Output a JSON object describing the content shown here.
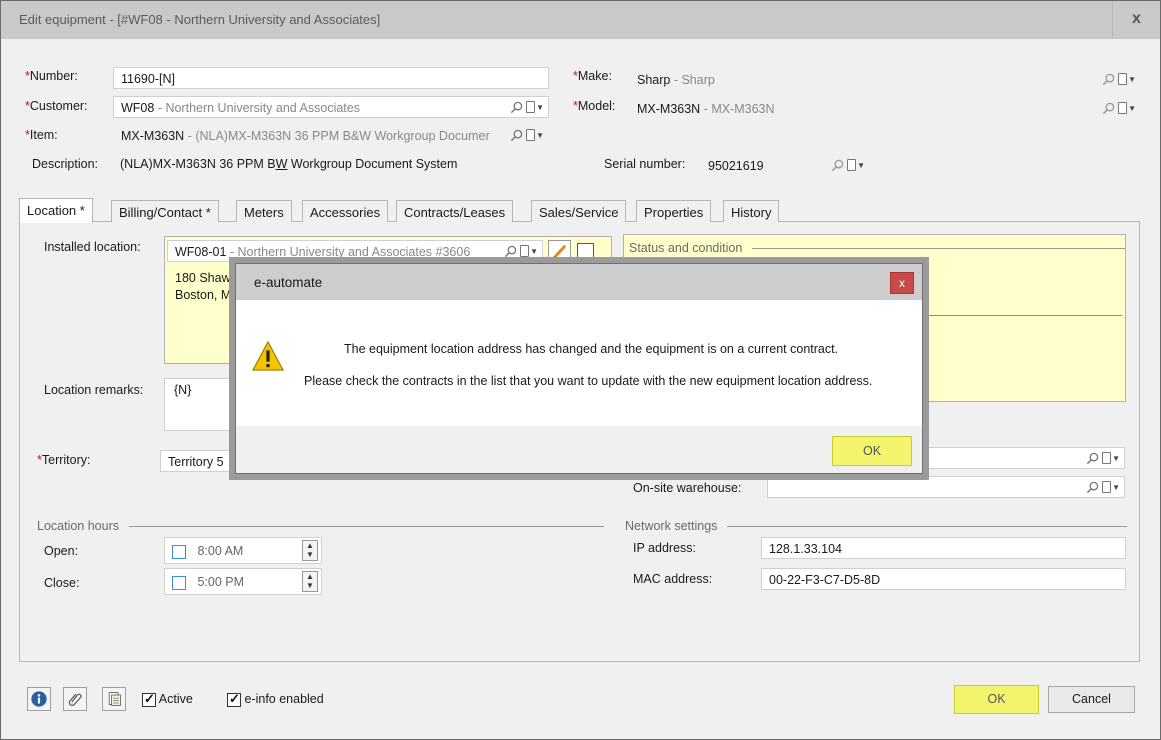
{
  "window": {
    "title": "Edit equipment - [#WF08 - Northern University and Associates]",
    "close_glyph": "x"
  },
  "header": {
    "number": {
      "label": "Number:",
      "value": "11690-[N]"
    },
    "customer": {
      "label": "Customer:",
      "code": "WF08",
      "name": " - Northern University and Associates"
    },
    "item": {
      "label": "Item:",
      "code": "MX-M363N",
      "name": " - (NLA)MX-M363N 36 PPM B&W Workgroup Documer"
    },
    "description": {
      "label": "Description:",
      "value_pre": "(NLA)MX-M363N 36 PPM B",
      "value_u": "W",
      "value_post": " Workgroup Document System"
    },
    "make": {
      "label": "Make:",
      "code": "Sharp",
      "name": " - Sharp"
    },
    "model": {
      "label": "Model:",
      "code": "MX-M363N",
      "name": " - MX-M363N"
    },
    "serial": {
      "label": "Serial number:",
      "value": "95021619"
    },
    "required_mark": "*"
  },
  "tabs": [
    "Location *",
    "Billing/Contact *",
    "Meters",
    "Accessories",
    "Contracts/Leases",
    "Sales/Service",
    "Properties",
    "History"
  ],
  "location": {
    "installed_label": "Installed location:",
    "installed_code": "WF08-01",
    "installed_name": " - Northern University and Associates #3606",
    "address_line1": "180 Shawm",
    "address_line2": "Boston, M.",
    "status_title": "Status and condition",
    "remarks_label": "Location remarks:",
    "remarks_value": "{N}",
    "territory_label": "Territory:",
    "territory_value": "Territory 5",
    "onsite_label": "On-site warehouse:",
    "hours_title": "Location hours",
    "open_label": "Open:",
    "open_value": "8:00 AM",
    "close_label": "Close:",
    "close_value": "5:00 PM",
    "network_title": "Network settings",
    "ip_label": "IP address:",
    "ip_value": "128.1.33.104",
    "mac_label": "MAC address:",
    "mac_value": "00-22-F3-C7-D5-8D"
  },
  "footer": {
    "active_label": "Active",
    "einfo_label": "e-info enabled",
    "ok_label": "OK",
    "cancel_label": "Cancel"
  },
  "dialog": {
    "title": "e-automate",
    "close_glyph": "x",
    "line1": "The equipment location address has changed and the equipment is on a current contract.",
    "line2": "Please check the contracts in the list that you want to update with the new equipment location address.",
    "ok_label": "OK"
  },
  "colors": {
    "highlight": "#f2f56c",
    "required": "#d01010",
    "yellow_panel": "#ffffcc"
  }
}
